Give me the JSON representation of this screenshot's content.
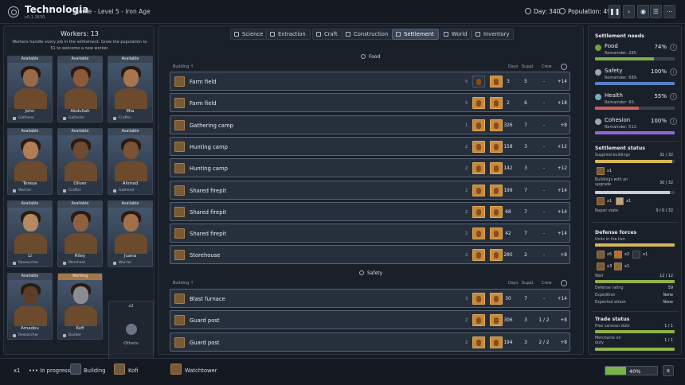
{
  "header": {
    "title": "Technologia",
    "version": "v0.1.2630",
    "subtitle": "Rome - Level 5 - Iron Age",
    "day": "Day: 340",
    "population": "Population: 49",
    "buttons": [
      "pause-icon",
      "play-icon",
      "speed-icon",
      "settings-icon",
      "menu-icon"
    ]
  },
  "workers": {
    "title": "Workers: 13",
    "description": "Workers handle every job in the settlement. Grow the population to 51 to welcome a new worker.",
    "cards": [
      {
        "status": "Available",
        "name": "John",
        "role": "Gatherer"
      },
      {
        "status": "Available",
        "name": "Abdullah",
        "role": "Gatherer"
      },
      {
        "status": "Available",
        "name": "Mia",
        "role": "Crafter"
      },
      {
        "status": "Available",
        "name": "Teresa",
        "role": "Warrior"
      },
      {
        "status": "Available",
        "name": "Oliver",
        "role": "Crafter"
      },
      {
        "status": "Available",
        "name": "Ahmed",
        "role": "Gatherer"
      },
      {
        "status": "Available",
        "name": "Li",
        "role": "Researcher"
      },
      {
        "status": "Available",
        "name": "Riley",
        "role": "Merchant"
      },
      {
        "status": "Available",
        "name": "Juana",
        "role": "Warrior"
      },
      {
        "status": "Available",
        "name": "Amadou",
        "role": "Researcher"
      },
      {
        "status": "Working",
        "name": "Kofi",
        "role": "Builder"
      }
    ],
    "others_count": "x2",
    "others_label": "Others"
  },
  "tabs": [
    {
      "label": "Science",
      "active": false
    },
    {
      "label": "Extraction",
      "active": false
    },
    {
      "label": "Craft",
      "active": false
    },
    {
      "label": "Construction",
      "active": false
    },
    {
      "label": "Settlement",
      "active": true
    },
    {
      "label": "World",
      "active": false
    },
    {
      "label": "Inventory",
      "active": false
    }
  ],
  "food": {
    "heading": "Food",
    "columns": {
      "building": "Building",
      "days": "Days",
      "supply": "Suppl.",
      "crew": "Crew"
    },
    "rows": [
      {
        "name": "Farm field",
        "level": "5",
        "days": "3",
        "supply": "5",
        "crew": "-",
        "value": "+14"
      },
      {
        "name": "Farm field",
        "level": "5",
        "days": "2",
        "supply": "6",
        "crew": "-",
        "value": "+18"
      },
      {
        "name": "Gathering camp",
        "level": "1",
        "days": "326",
        "supply": "7",
        "crew": "-",
        "value": "+8"
      },
      {
        "name": "Hunting camp",
        "level": "2",
        "days": "158",
        "supply": "3",
        "crew": "-",
        "value": "+12"
      },
      {
        "name": "Hunting camp",
        "level": "2",
        "days": "142",
        "supply": "3",
        "crew": "-",
        "value": "+12"
      },
      {
        "name": "Shared firepit",
        "level": "2",
        "days": "199",
        "supply": "7",
        "crew": "-",
        "value": "+14"
      },
      {
        "name": "Shared firepit",
        "level": "2",
        "days": "68",
        "supply": "7",
        "crew": "-",
        "value": "+14"
      },
      {
        "name": "Shared firepit",
        "level": "2",
        "days": "42",
        "supply": "7",
        "crew": "-",
        "value": "+14"
      },
      {
        "name": "Storehouse",
        "level": "2",
        "days": "280",
        "supply": "2",
        "crew": "-",
        "value": "+8"
      }
    ]
  },
  "safety": {
    "heading": "Safety",
    "columns": {
      "building": "Building",
      "days": "Days",
      "supply": "Suppl.",
      "crew": "Crew"
    },
    "rows": [
      {
        "name": "Blast furnace",
        "level": "3",
        "days": "30",
        "supply": "7",
        "crew": "-",
        "value": "+14"
      },
      {
        "name": "Guard post",
        "level": "2",
        "days": "306",
        "supply": "3",
        "crew": "1 / 2",
        "value": "+8"
      },
      {
        "name": "Guard post",
        "level": "2",
        "days": "194",
        "supply": "3",
        "crew": "2 / 2",
        "value": "+8"
      }
    ]
  },
  "needs": {
    "title": "Settlement needs",
    "items": [
      {
        "name": "Food",
        "pct": "74%",
        "remainder": "Remainder: 295.",
        "fill": 0.74,
        "color": "#7db04a",
        "icon_color": "#6aa33d"
      },
      {
        "name": "Safety",
        "pct": "100%",
        "remainder": "Remainder: 689.",
        "fill": 1.0,
        "color": "#5a82c8",
        "icon_color": "#9aa6b6"
      },
      {
        "name": "Health",
        "pct": "55%",
        "remainder": "Remainder: 60.",
        "fill": 0.55,
        "color": "#d35b5b",
        "icon_color": "#6fb0c9"
      },
      {
        "name": "Cohesion",
        "pct": "100%",
        "remainder": "Remainder: 512.",
        "fill": 1.0,
        "color": "#9a62d6",
        "icon_color": "#9aa6b6"
      }
    ]
  },
  "status": {
    "title": "Settlement status",
    "supplied_label": "Supplied buildings",
    "supplied_value": "31 / 32",
    "supplied_fill": 0.97,
    "supplied_icon_count": "x1",
    "upgrade_label": "Buildings with an upgrade",
    "upgrade_value": "30 / 32",
    "upgrade_fill": 0.94,
    "upgrade_counts": [
      "x1",
      "x1"
    ],
    "repair_label": "Repair state",
    "repair_value": "0 / 0 / 32"
  },
  "defense": {
    "title": "Defense forces",
    "units_label": "Units in the lien",
    "unit_counts": [
      "x5",
      "x2",
      "x1",
      "x3",
      "x1"
    ],
    "wall_label": "Wall",
    "wall_value": "12 / 12",
    "rating_label": "Defense rating",
    "rating_value": "59",
    "expedition_label": "Expedition",
    "expedition_value": "None",
    "attack_label": "Expected attack",
    "attack_value": "None"
  },
  "trade": {
    "title": "Trade status",
    "caravan_label": "Free caravan slots",
    "caravan_value": "1 / 1",
    "merchants_label": "Merchants on duty",
    "merchants_value": "1 / 1"
  },
  "bottom": {
    "count": "x1",
    "in_progress": "In progress",
    "building_label": "Building",
    "worker": "Kofi",
    "target": "Watchtower",
    "progress_text": "40%",
    "progress": 0.4,
    "close": "x"
  }
}
